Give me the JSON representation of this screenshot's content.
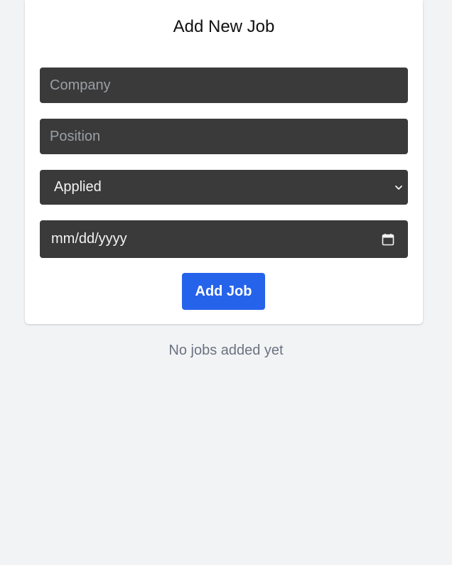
{
  "form": {
    "title": "Add New Job",
    "company_placeholder": "Company",
    "position_placeholder": "Position",
    "status_selected": "Applied",
    "date_placeholder": "mm/dd/yyyy",
    "submit_label": "Add Job"
  },
  "jobs": {
    "empty_message": "No jobs added yet"
  },
  "colors": {
    "accent": "#2563eb",
    "input_bg": "#3a3a3a",
    "page_bg": "#f2f3f5"
  },
  "icons": {
    "status_dropdown": "chevron-down-icon",
    "date_picker": "calendar-icon"
  }
}
